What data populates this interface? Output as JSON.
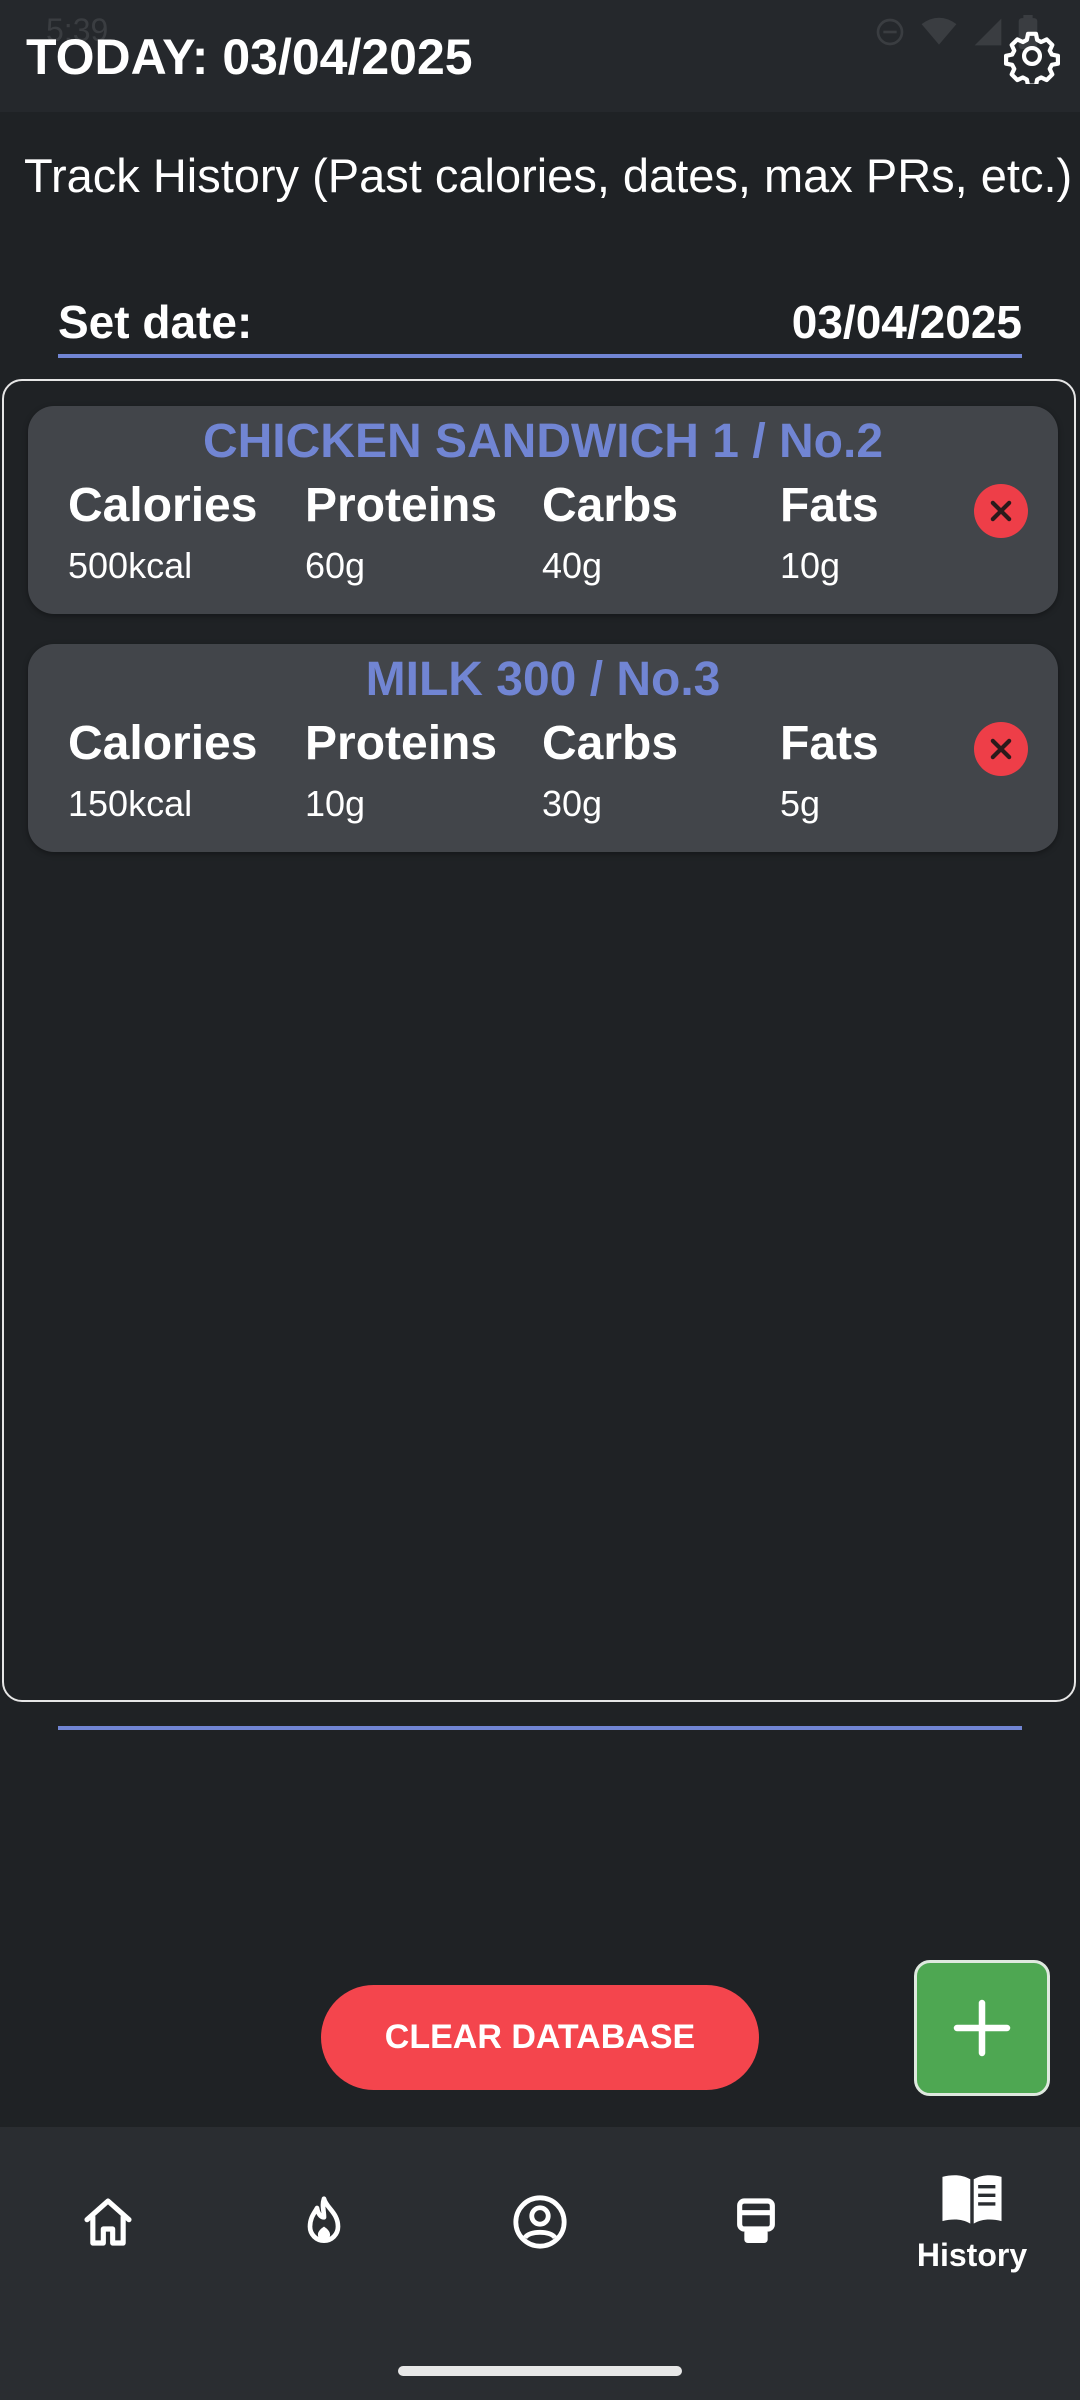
{
  "status_bar": {
    "time": "5:39"
  },
  "header": {
    "title": "TODAY: 03/04/2025",
    "settings_icon": "gear-icon"
  },
  "subtitle": "Track History (Past calories, dates, max PRs, etc.)",
  "date_picker": {
    "label": "Set date:",
    "value": "03/04/2025"
  },
  "entries": [
    {
      "title": "CHICKEN SANDWICH 1 / No.2",
      "calories_label": "Calories",
      "calories": "500kcal",
      "proteins_label": "Proteins",
      "proteins": "60g",
      "carbs_label": "Carbs",
      "carbs": "40g",
      "fats_label": "Fats",
      "fats": "10g"
    },
    {
      "title": "MILK 300 / No.3",
      "calories_label": "Calories",
      "calories": "150kcal",
      "proteins_label": "Proteins",
      "proteins": "10g",
      "carbs_label": "Carbs",
      "carbs": "30g",
      "fats_label": "Fats",
      "fats": "5g"
    }
  ],
  "actions": {
    "clear_label": "CLEAR DATABASE",
    "add_icon": "plus-icon"
  },
  "nav": {
    "items": [
      {
        "icon": "home-icon"
      },
      {
        "icon": "flame-icon"
      },
      {
        "icon": "profile-icon"
      },
      {
        "icon": "workout-icon"
      },
      {
        "icon": "book-icon",
        "label": "History",
        "active": true
      }
    ]
  },
  "colors": {
    "background": "#1f2225",
    "accent": "#7185d3",
    "card": "#42454a",
    "danger": "#f4454d",
    "add": "#4ea752"
  }
}
